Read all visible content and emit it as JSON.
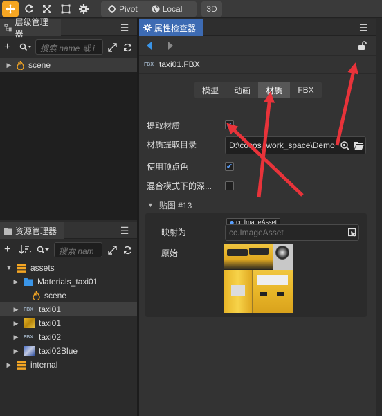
{
  "toolbar": {
    "pivot": "Pivot",
    "local": "Local",
    "mode3d": "3D"
  },
  "hierarchy": {
    "title": "层级管理器",
    "search_placeholder": "搜索 name 或 i",
    "items": [
      {
        "label": "scene"
      }
    ]
  },
  "assets": {
    "title": "资源管理器",
    "search_placeholder": "搜索 nam",
    "items": [
      {
        "label": "assets"
      },
      {
        "label": "Materials_taxi01"
      },
      {
        "label": "scene"
      },
      {
        "label": "taxi01"
      },
      {
        "label": "taxi01"
      },
      {
        "label": "taxi02"
      },
      {
        "label": "taxi02Blue"
      },
      {
        "label": "internal"
      }
    ]
  },
  "inspector": {
    "title": "属性检查器",
    "file_badge": "FBX",
    "file_name": "taxi01.FBX",
    "tabs": [
      "模型",
      "动画",
      "材质",
      "FBX"
    ],
    "active_tab": "材质",
    "props": {
      "extract_material": "提取材质",
      "extract_dir": "材质提取目录",
      "extract_dir_value": "D:\\cocos_work_space\\Demo",
      "use_vertex_color": "使用顶点色",
      "depth_in_blend": "混合模式下的深...",
      "texture_section": "贴图 #13",
      "map_to": "映射为",
      "asset_type_tag": "cc.ImageAsset",
      "asset_placeholder": "cc.ImageAsset",
      "original": "原始"
    }
  },
  "colors": {
    "accent_blue": "#3d6bb3",
    "accent_orange": "#f5a623",
    "arrow_red": "#e8333a"
  }
}
